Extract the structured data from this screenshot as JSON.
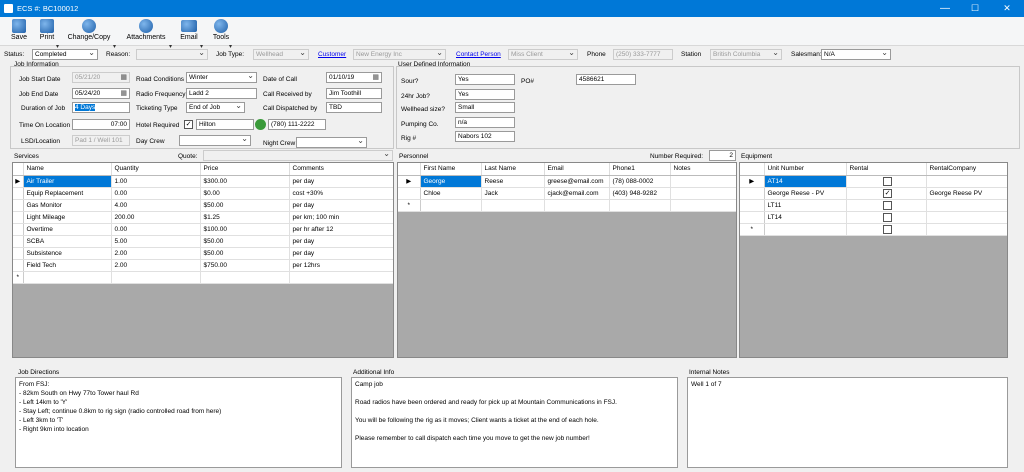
{
  "window": {
    "title": "ECS #: BC100012",
    "min": "—",
    "max": "☐",
    "close": "✕"
  },
  "toolbar": {
    "save": "Save",
    "print": "Print",
    "change_copy": "Change/Copy",
    "attachments": "Attachments",
    "email": "Email",
    "tools": "Tools"
  },
  "header": {
    "status_label": "Status:",
    "status": "Completed",
    "reason_label": "Reason:",
    "reason": "",
    "job_type_label": "Job Type:",
    "job_type": "Wellhead",
    "customer_label": "Customer",
    "customer": "New Energy Inc",
    "contact_label": "Contact Person",
    "contact": "Miss Client",
    "phone_label": "Phone",
    "phone": "(250) 333-7777",
    "station_label": "Station",
    "station": "British Columbia",
    "salesman_label": "Salesman:",
    "salesman": "N/A"
  },
  "job": {
    "section": "Job Information",
    "start_label": "Job Start Date",
    "start": "05/21/20",
    "end_label": "Job End Date",
    "end": "05/24/20",
    "duration_label": "Duration of Job",
    "duration": "4 Days",
    "time_on_label": "Time On Location",
    "time_on": "07:00",
    "lsd_label": "LSD/Location",
    "lsd": "Pad 1 / Well 101",
    "road_label": "Road Conditions",
    "road": "Winter",
    "radio_label": "Radio Frequency",
    "radio": "Ladd 2",
    "ticketing_label": "Ticketing Type",
    "ticketing": "End of Job",
    "hotel_label": "Hotel Required",
    "hotel": "Hilton",
    "hotel_checked": "✓",
    "hotel_phone": "(780) 111-2222",
    "daycrew_label": "Day Crew",
    "daycrew": "",
    "doc_label": "Date of Call",
    "doc": "01/10/19",
    "received_label": "Call Received by",
    "received": "Jim Toothill",
    "dispatched_label": "Call Dispatched by",
    "dispatched": "TBD",
    "nightcrew_label": "Night Crew",
    "nightcrew": ""
  },
  "udi": {
    "section": "User Defined Information",
    "sour_label": "Sour?",
    "sour": "Yes",
    "po_label": "PO#",
    "po": "4586621",
    "job24_label": "24hr Job?",
    "job24": "Yes",
    "wellhead_label": "Wellhead size?",
    "wellhead": "Small",
    "pumping_label": "Pumping Co.",
    "pumping": "n/a",
    "rig_label": "Rig #",
    "rig": "Nabors 102"
  },
  "services": {
    "section": "Services",
    "quote_label": "Quote:",
    "quote": "",
    "cols": [
      "Name",
      "Quantity",
      "Price",
      "Comments"
    ],
    "rows": [
      [
        "Air Trailer",
        "1.00",
        "$300.00",
        "per day"
      ],
      [
        "Equip Replacement",
        "0.00",
        "$0.00",
        "cost +30%"
      ],
      [
        "Gas Monitor",
        "4.00",
        "$50.00",
        "per day"
      ],
      [
        "Light Mileage",
        "200.00",
        "$1.25",
        "per km; 100 min"
      ],
      [
        "Overtime",
        "0.00",
        "$100.00",
        "per hr after 12"
      ],
      [
        "SCBA",
        "5.00",
        "$50.00",
        "per day"
      ],
      [
        "Subsistence",
        "2.00",
        "$50.00",
        "per day"
      ],
      [
        "Field Tech",
        "2.00",
        "$750.00",
        "per 12hrs"
      ]
    ],
    "new_row_marker": "*",
    "current_marker": "▶"
  },
  "personnel": {
    "section": "Personnel",
    "required_label": "Number Required:",
    "required": "2",
    "cols": [
      "First Name",
      "Last Name",
      "Email",
      "Phone1",
      "Notes"
    ],
    "rows": [
      [
        "George",
        "Reese",
        "greese@email.com",
        "(78) 088-0002",
        ""
      ],
      [
        "Chloe",
        "Jack",
        "cjack@email.com",
        "(403) 948-9282",
        ""
      ]
    ],
    "new_row_marker": "*",
    "current_marker": "▶"
  },
  "equipment": {
    "section": "Equipment",
    "cols": [
      "Unit Number",
      "Rental",
      "RentalCompany"
    ],
    "rows": [
      [
        "AT14",
        "",
        ""
      ],
      [
        "George Reese - PV",
        "✓",
        "George Reese PV"
      ],
      [
        "LT11",
        "",
        ""
      ],
      [
        "LT14",
        "",
        ""
      ]
    ],
    "new_row_marker": "*",
    "current_marker": "▶"
  },
  "directions": {
    "section": "Job Directions",
    "lines": [
      "From FSJ:",
      "- 82km South on Hwy 77to Tower haul Rd",
      "- Left 14km to 'Y'",
      "- Stay Left; continue 0.8km to rig sign (radio controlled road from here)",
      "- Left 3km to 'T'",
      "- Right 9km into location"
    ]
  },
  "additional": {
    "section": "Additional Info",
    "lines": [
      "Camp job",
      "",
      "Road radios have been ordered and ready for pick up at Mountain Communications in FSJ.",
      "",
      "You will be following the rig as it moves; Client wants a ticket at the end of each hole.",
      "",
      "Please remember to call dispatch each time you move to get the new job number!"
    ]
  },
  "internal": {
    "section": "Internal Notes",
    "lines": [
      "Well 1 of 7"
    ]
  }
}
